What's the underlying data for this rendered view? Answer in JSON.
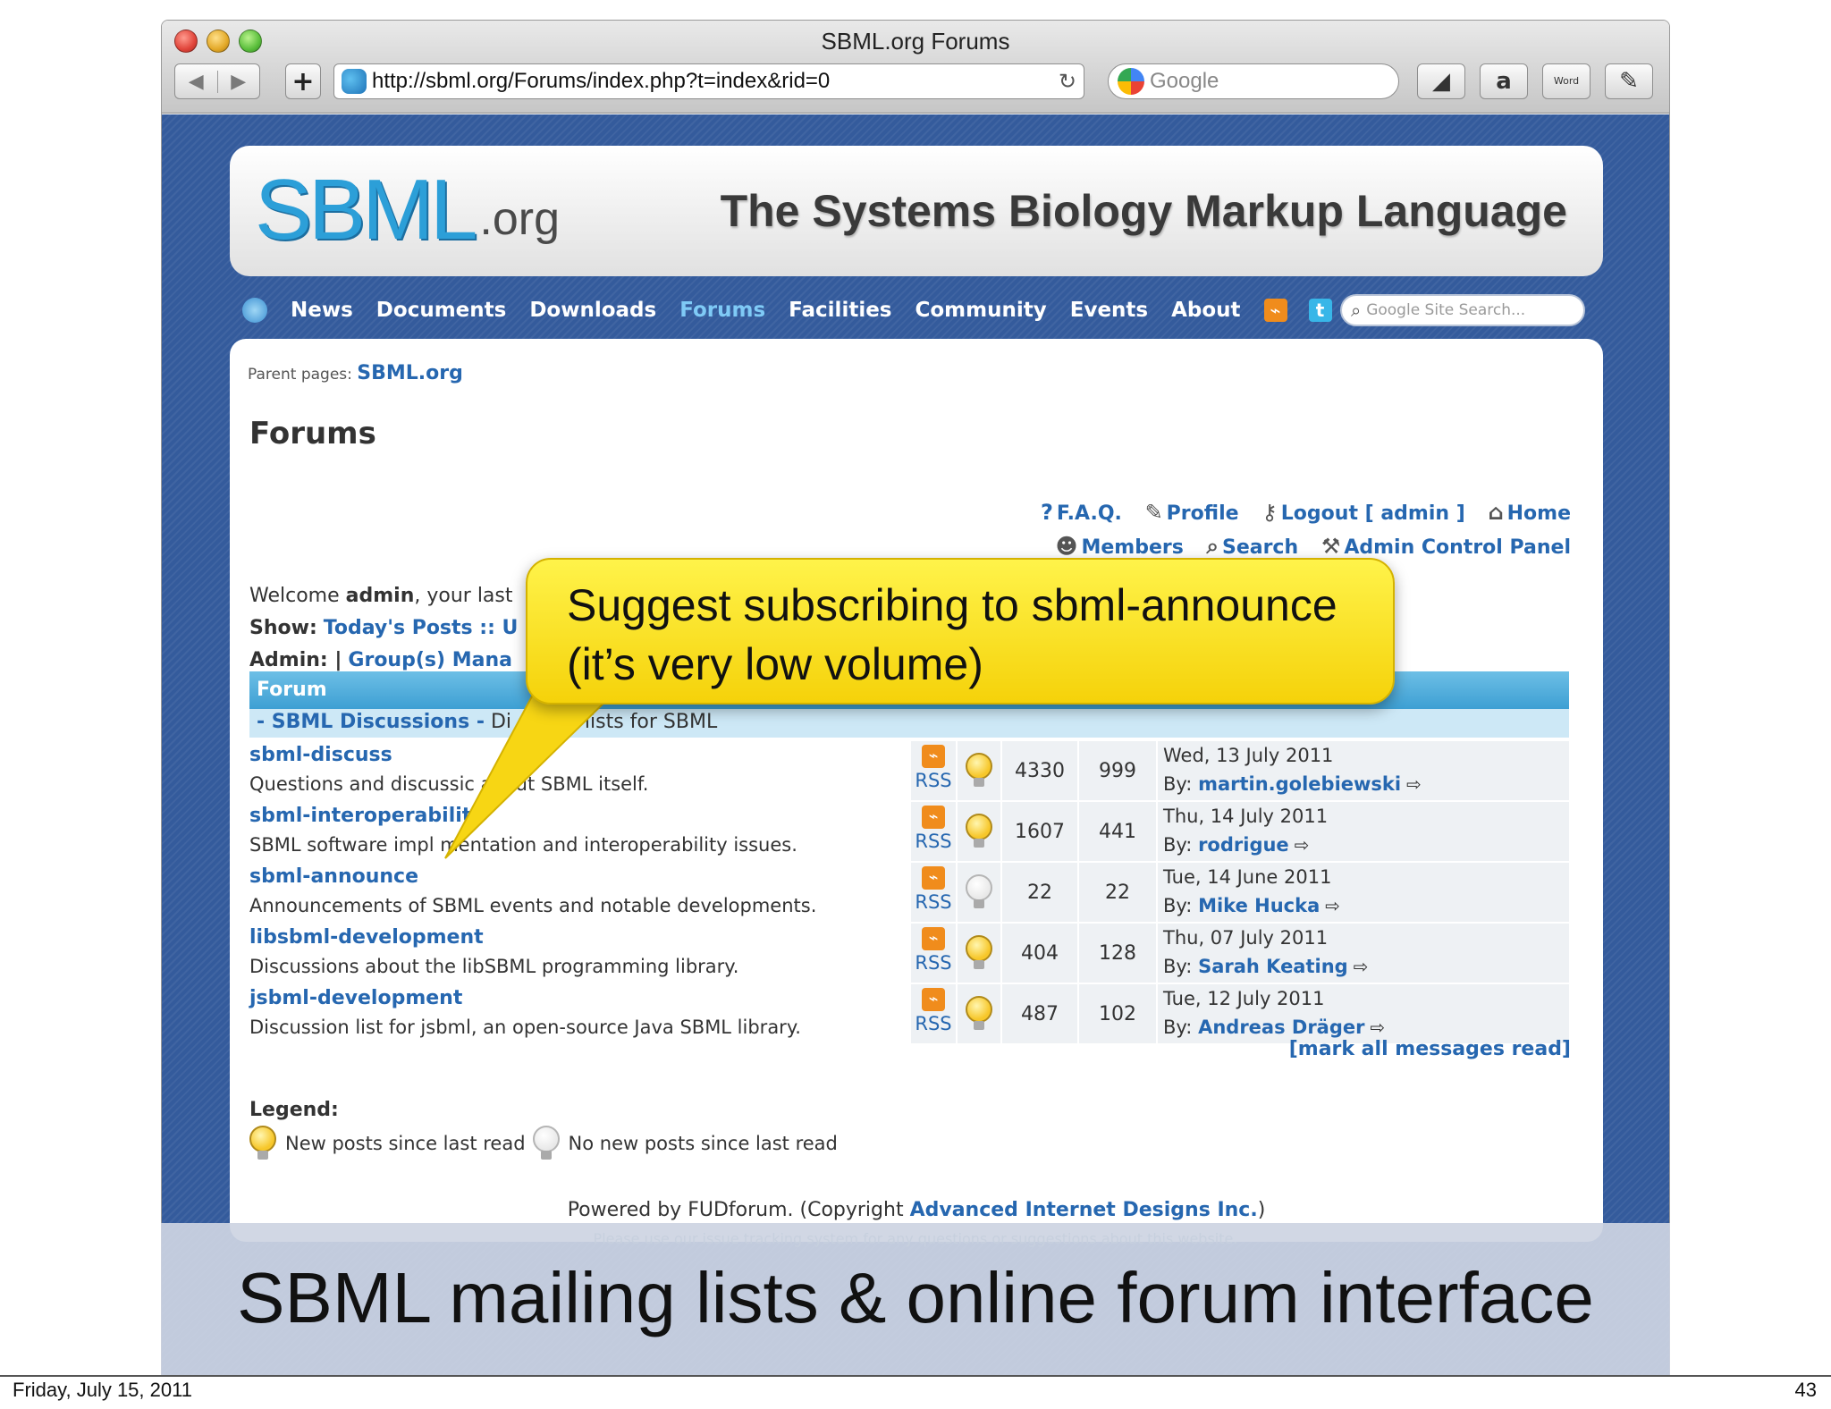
{
  "browser": {
    "window_title": "SBML.org Forums",
    "back_glyph": "◀",
    "forward_glyph": "▶",
    "add_glyph": "+",
    "url": "http://sbml.org/Forums/index.php?t=index&rid=0",
    "reload_glyph": "↻",
    "search_placeholder": "Google",
    "tools": [
      {
        "icon": "bird-icon",
        "glyph": "◢"
      },
      {
        "icon": "amazon-icon",
        "glyph": "a"
      },
      {
        "icon": "word-icon",
        "glyph": "Word"
      },
      {
        "icon": "evernote-icon",
        "glyph": "✎"
      }
    ]
  },
  "site": {
    "logo_mark": "SBML",
    "logo_tld": ".org",
    "tagline": "The Systems Biology Markup Language",
    "nav": [
      "News",
      "Documents",
      "Downloads",
      "Forums",
      "Facilities",
      "Community",
      "Events",
      "About"
    ],
    "nav_active": "Forums",
    "site_search_placeholder": "Google Site Search..."
  },
  "page": {
    "parent_pages_label": "Parent pages:",
    "parent_pages_link": "SBML.org",
    "title": "Forums",
    "user_links_row1": [
      {
        "icon": "faq-icon",
        "glyph": "?",
        "label": "F.A.Q."
      },
      {
        "icon": "profile-icon",
        "glyph": "✎",
        "label": "Profile"
      },
      {
        "icon": "logout-icon",
        "glyph": "⚷",
        "label": "Logout [ admin ]"
      },
      {
        "icon": "home-icon",
        "glyph": "⌂",
        "label": "Home"
      }
    ],
    "user_links_row2": [
      {
        "icon": "members-icon",
        "glyph": "☻",
        "label": "Members"
      },
      {
        "icon": "search-icon",
        "glyph": "⌕",
        "label": "Search"
      },
      {
        "icon": "admin-icon",
        "glyph": "⚒",
        "label": "Admin Control Panel"
      }
    ],
    "welcome_prefix": "Welcome",
    "welcome_user": "admin",
    "welcome_suffix": ", your last",
    "show_label": "Show:",
    "show_link": "Today's Posts :: U",
    "admin_label": "Admin: |",
    "admin_link": "Group(s) Mana",
    "forum_header": "Forum",
    "section_name": "- SBML Discussions -",
    "section_desc": " Di    ssions lists for SBML",
    "rss_glyph": "⌁",
    "arrow_glyph": "⇨",
    "forums": [
      {
        "name": "sbml-discuss",
        "desc": "Questions and discussic    about SBML itself.",
        "rss": "RSS",
        "new_posts": true,
        "topics": "4330",
        "posts": "999",
        "last_date": "Wed, 13 July 2011",
        "by_label": "By:",
        "by": "martin.golebiewski"
      },
      {
        "name": "sbml-interoperabilit",
        "desc": "SBML software impl   mentation and interoperability issues.",
        "rss": "RSS",
        "new_posts": true,
        "topics": "1607",
        "posts": "441",
        "last_date": "Thu, 14 July 2011",
        "by_label": "By:",
        "by": "rodrigue"
      },
      {
        "name": "sbml-announce",
        "desc": "Announcements of SBML events and notable developments.",
        "rss": "RSS",
        "new_posts": false,
        "topics": "22",
        "posts": "22",
        "last_date": "Tue, 14 June 2011",
        "by_label": "By:",
        "by": "Mike Hucka"
      },
      {
        "name": "libsbml-development",
        "desc": "Discussions about the libSBML programming library.",
        "rss": "RSS",
        "new_posts": true,
        "topics": "404",
        "posts": "128",
        "last_date": "Thu, 07 July 2011",
        "by_label": "By:",
        "by": "Sarah Keating"
      },
      {
        "name": "jsbml-development",
        "desc": "Discussion list for jsbml, an open-source Java SBML library.",
        "rss": "RSS",
        "new_posts": true,
        "topics": "487",
        "posts": "102",
        "last_date": "Tue, 12 July 2011",
        "by_label": "By:",
        "by": "Andreas Dräger"
      }
    ],
    "mark_all_read": "[mark all messages read]",
    "legend_title": "Legend:",
    "legend_new": "New posts since last read",
    "legend_none": "No new posts since last read",
    "powered_prefix": "Powered by FUDforum. (Copyright ",
    "powered_link": "Advanced Internet Designs Inc.",
    "powered_suffix": ")",
    "faint_footer": "Please use our issue tracking system for any questions or suggestions about this website."
  },
  "callout": {
    "line1": "Suggest subscribing to sbml-announce",
    "line2": "(it’s very low volume)"
  },
  "slide": {
    "caption": "SBML mailing lists & online forum interface",
    "date": "Friday, July 15, 2011",
    "page_number": "43"
  },
  "colors": {
    "page_blue": "#345b9c",
    "link_blue": "#2667b0",
    "callout_yellow": "#fff34a",
    "rss_orange": "#f08c1c"
  }
}
